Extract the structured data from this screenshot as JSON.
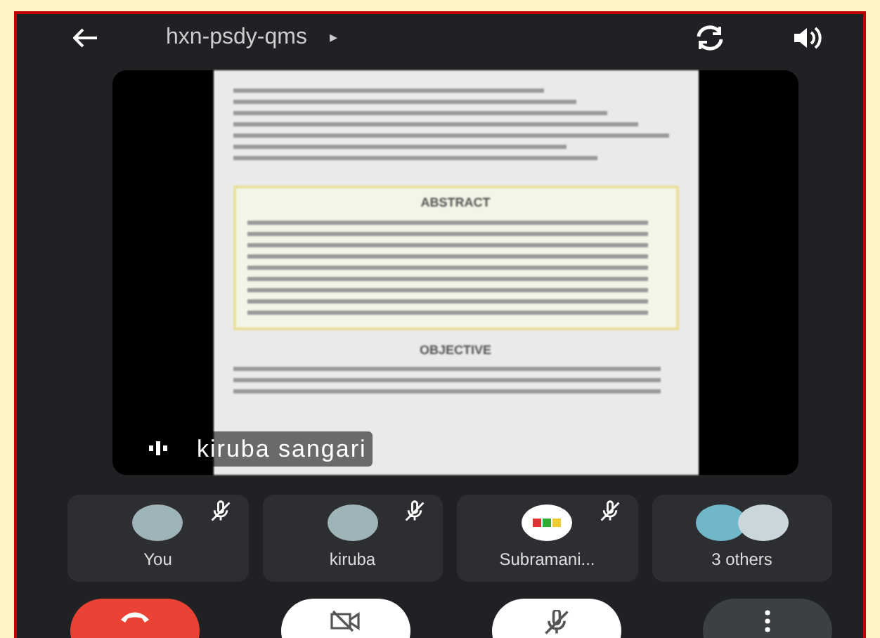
{
  "top_bar": {
    "title": "hxn-psdy-qms",
    "title_arrow": "▸"
  },
  "shared_screen": {
    "presenter": "kiruba sangari",
    "document": {
      "headings": [
        "ABSTRACT",
        "OBJECTIVE"
      ]
    }
  },
  "participants": [
    {
      "name": "You",
      "muted": true,
      "kind": "photo"
    },
    {
      "name": "kiruba",
      "muted": true,
      "kind": "photo"
    },
    {
      "name": "Subramani...",
      "muted": true,
      "kind": "logo"
    },
    {
      "name": "3 others",
      "muted": false,
      "kind": "group"
    }
  ],
  "controls": [
    {
      "kind": "end-call"
    },
    {
      "kind": "camera",
      "on": false
    },
    {
      "kind": "mic",
      "on": false
    },
    {
      "kind": "more"
    }
  ]
}
